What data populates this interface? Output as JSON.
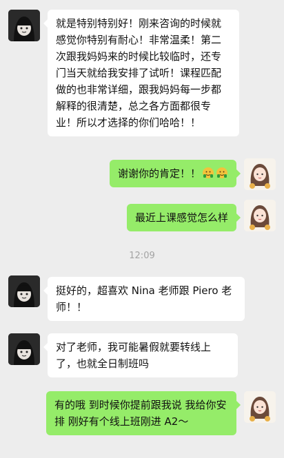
{
  "messages": [
    {
      "side": "left",
      "text": "就是特别特别好！刚来咨询的时候就感觉你特别有耐心！非常温柔！第二次跟我妈妈来的时候比较临时，还专门当天就给我安排了试听！课程匹配做的也非常详细，跟我妈妈每一步都解释的很清楚，总之各方面都很专业！所以才选择的你们哈哈！！"
    },
    {
      "side": "right",
      "text": "谢谢你的肯定！！",
      "emoji": [
        "thumbs-up-emoji",
        "thumbs-up-emoji"
      ]
    },
    {
      "side": "right",
      "text": "最近上课感觉怎么样"
    },
    {
      "side": "left",
      "text": "挺好的，超喜欢 Nina 老师跟 Piero 老师！！"
    },
    {
      "side": "left",
      "text": "对了老师，我可能暑假就要转线上了，也就全日制班吗"
    },
    {
      "side": "right",
      "text": "有的哦 到时候你提前跟我说 我给你安排 刚好有个线上班刚进 A2～"
    }
  ],
  "timestamp": "12:09",
  "colors": {
    "background": "#ededed",
    "bubble_self": "#95ec69",
    "bubble_other": "#ffffff",
    "timestamp_text": "#a3a3a3"
  }
}
